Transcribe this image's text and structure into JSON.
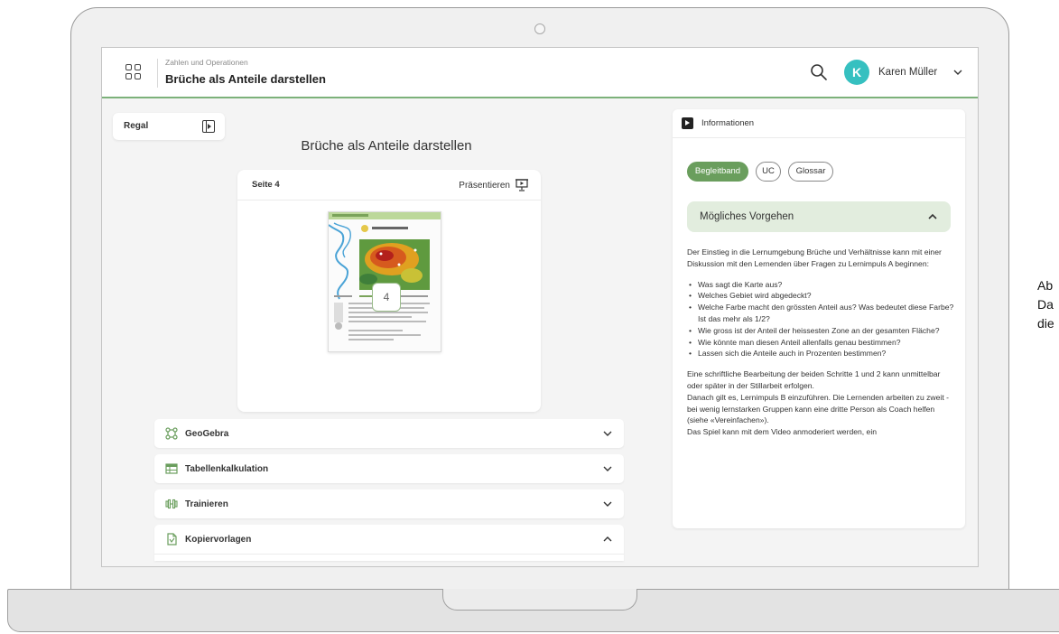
{
  "header": {
    "breadcrumb": "Zahlen und Operationen",
    "title": "Brüche als Anteile darstellen",
    "user_initial": "K",
    "user_name": "Karen Müller",
    "avatar_color": "#36c0c0",
    "accent_color": "#7cb17a"
  },
  "regal": {
    "label": "Regal"
  },
  "main": {
    "heading": "Brüche als Anteile darstellen",
    "page_card": {
      "page_label": "Seite 4",
      "present_label": "Präsentieren",
      "page_number": "4"
    },
    "accordions": [
      {
        "label": "GeoGebra",
        "icon": "geogebra-icon",
        "expanded": false
      },
      {
        "label": "Tabellenkalkulation",
        "icon": "spreadsheet-icon",
        "expanded": false
      },
      {
        "label": "Trainieren",
        "icon": "dumbbell-icon",
        "expanded": false
      },
      {
        "label": "Kopiervorlagen",
        "icon": "document-icon",
        "expanded": true
      }
    ]
  },
  "info": {
    "title": "Informationen",
    "chips": [
      "Begleitband",
      "UC",
      "Glossar"
    ],
    "active_chip": "Begleitband",
    "section_title": "Mögliches Vorgehen",
    "intro": "Der Einstieg in die Lernumgebung Brüche und Verhältnisse kann mit einer Diskussion mit den Lernenden über Fragen zu Lernimpuls A beginnen:",
    "questions": [
      "Was sagt die Karte aus?",
      "Welches Gebiet wird abgedeckt?",
      "Welche Farbe macht den grössten Anteil aus? Was bedeutet diese Farbe? Ist das mehr als 1/2?",
      "Wie gross ist der Anteil der heissesten Zone an der gesamten Fläche?",
      "Wie könnte man diesen Anteil allenfalls genau bestimmen?",
      "Lassen sich die Anteile auch in Prozenten bestimmen?"
    ],
    "outro": "Eine schriftliche Bearbeitung der beiden Schritte 1 und 2 kann unmittelbar oder später in der Stillarbeit erfolgen.\nDanach gilt es, Lernimpuls B einzuführen. Die Lernenden arbeiten zu zweit - bei wenig lernstarken Gruppen kann eine dritte Person als Coach helfen (siehe «Vereinfachen»).\nDas Spiel kann mit dem Video anmoderiert werden, ein"
  },
  "side_text": "Ab\nDa\ndie"
}
